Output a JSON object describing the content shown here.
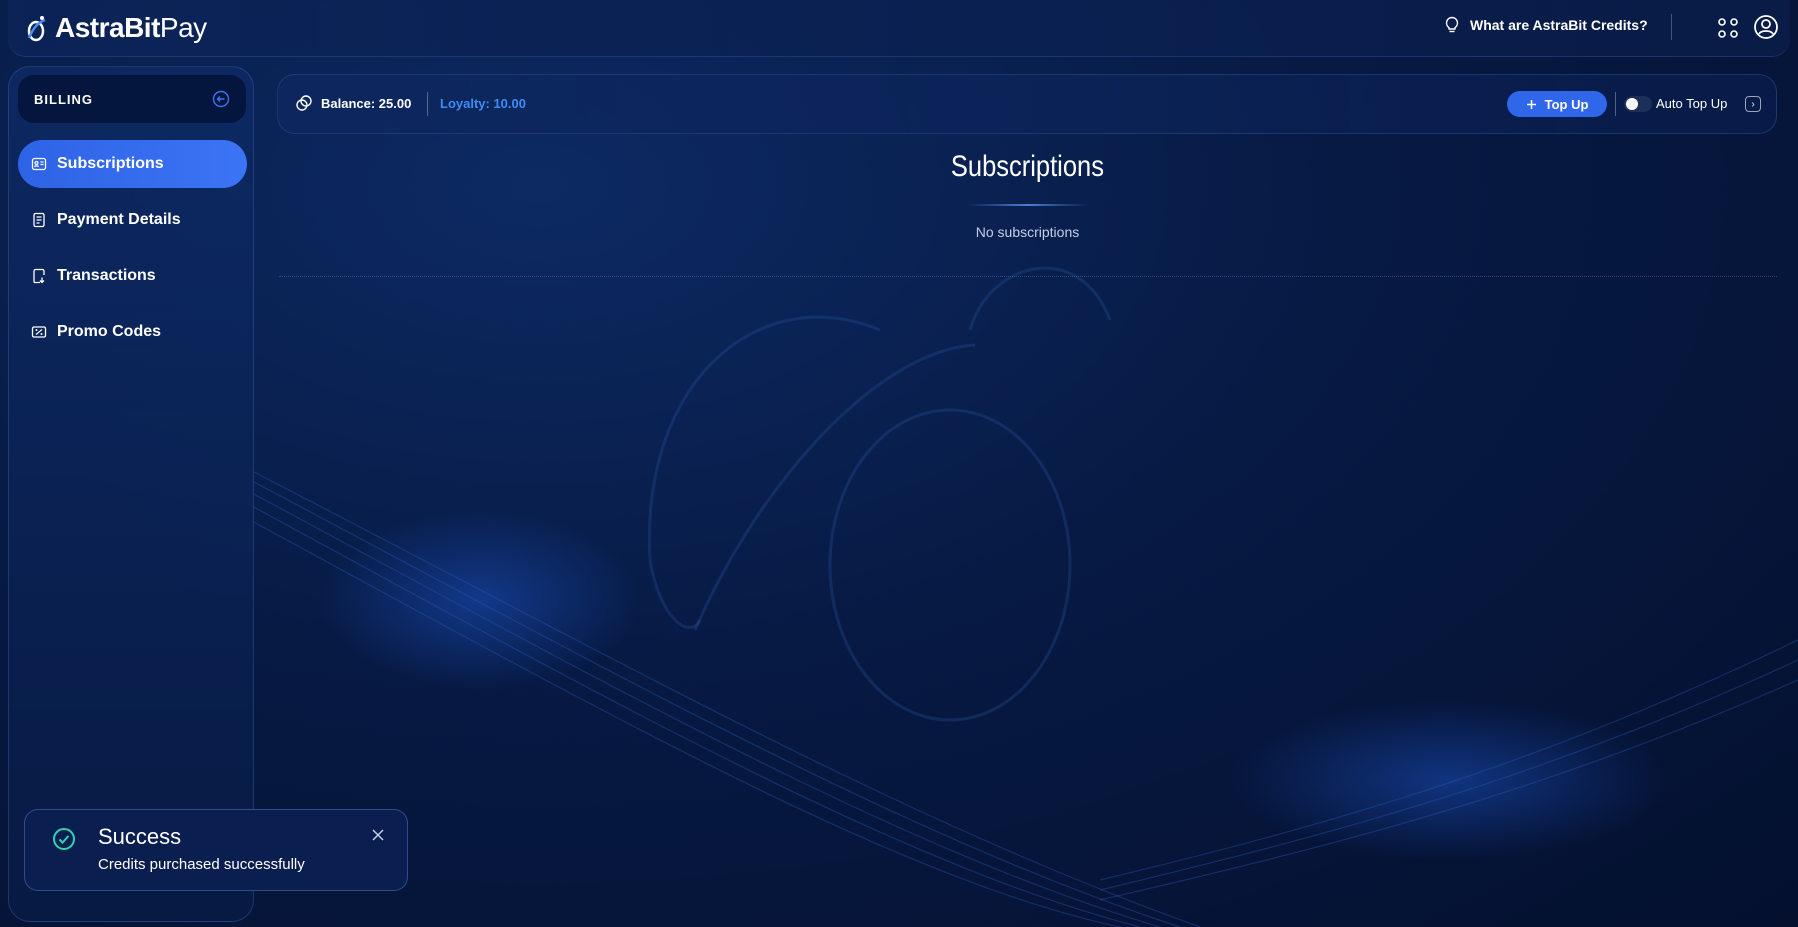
{
  "brand": {
    "name_bold": "AstraBit",
    "name_light": "Pay"
  },
  "header": {
    "help_link": "What are AstraBit Credits?",
    "icons": [
      "lightbulb-icon",
      "apps-grid-icon",
      "account-icon"
    ]
  },
  "sidebar": {
    "section_label": "BILLING",
    "items": [
      {
        "label": "Subscriptions",
        "icon": "subscriptions-icon",
        "active": true
      },
      {
        "label": "Payment Details",
        "icon": "payment-details-icon",
        "active": false
      },
      {
        "label": "Transactions",
        "icon": "transactions-icon",
        "active": false
      },
      {
        "label": "Promo Codes",
        "icon": "promo-codes-icon",
        "active": false
      }
    ]
  },
  "balance_bar": {
    "balance": "Balance: 25.00",
    "loyalty": "Loyalty: 10.00",
    "top_up_label": "Top Up",
    "auto_top_up_label": "Auto Top Up",
    "auto_top_up_enabled": false
  },
  "main": {
    "title": "Subscriptions",
    "empty_message": "No subscriptions"
  },
  "toast": {
    "title": "Success",
    "message": "Credits purchased successfully"
  },
  "colors": {
    "accent": "#2f66ea",
    "loyalty": "#3f8bf5",
    "success": "#2fd3b0",
    "background": "#071a44"
  }
}
